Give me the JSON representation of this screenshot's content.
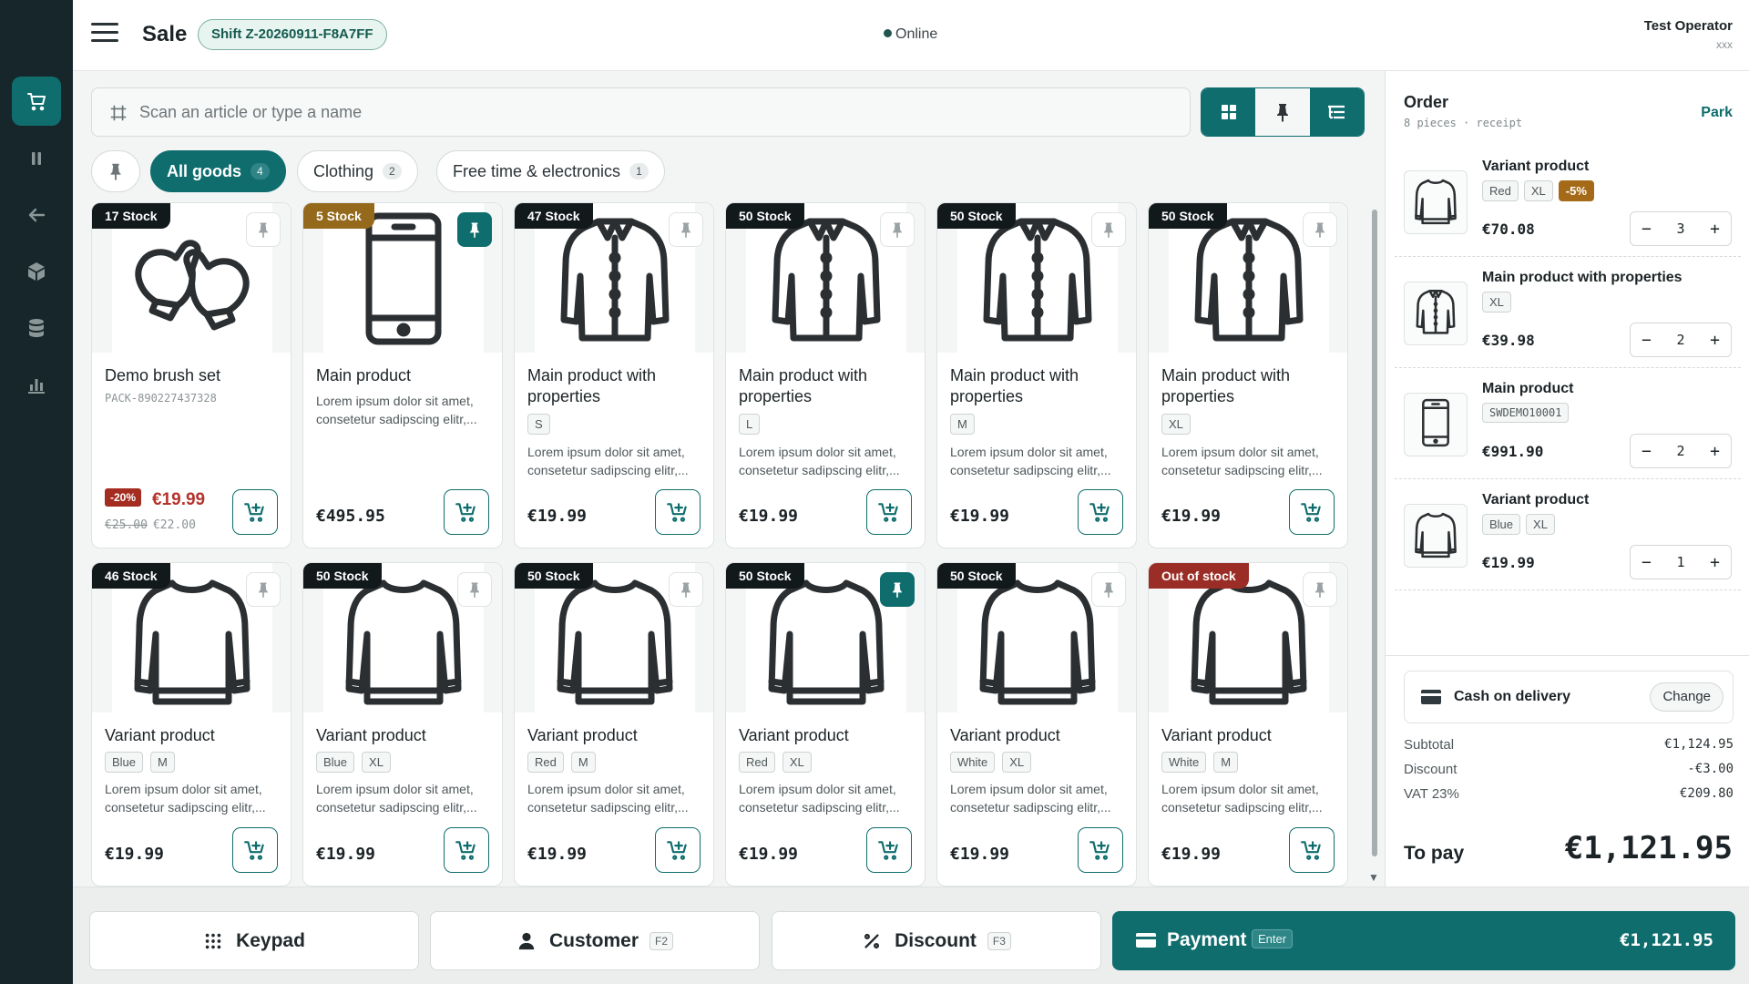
{
  "header": {
    "title": "Sale",
    "shift": "Shift Z-20260911-F8A7FF",
    "status": "Online",
    "user_name": "Test Operator",
    "user_sub": "xxx"
  },
  "rail": {
    "items": [
      "cart-icon",
      "pause-icon",
      "arrow-left-icon",
      "package-icon",
      "database-icon",
      "chart-icon"
    ],
    "active": "cart-icon"
  },
  "search": {
    "placeholder": "Scan an article or type a name",
    "value": ""
  },
  "view_toggle": {
    "icons": [
      "grid-icon",
      "pin-icon",
      "tree-icon"
    ]
  },
  "categories": [
    {
      "label": "All goods",
      "count": "4",
      "active": true
    },
    {
      "label": "Clothing",
      "count": "2"
    },
    {
      "label": "Free time & electronics",
      "count": "1"
    }
  ],
  "products": [
    {
      "stock": "17 Stock",
      "name": "Demo brush set",
      "sku": "PACK-890227437328",
      "discount_badge": "-20%",
      "price": "€19.99",
      "old_price": "€25.00",
      "old_price2": "€22.00",
      "image": "mittens",
      "pinned": false
    },
    {
      "stock": "5 Stock",
      "stock_level": "low",
      "name": "Main product",
      "desc": "Lorem ipsum dolor sit amet, consetetur sadipscing elitr,...",
      "price": "€495.95",
      "image": "phone",
      "pinned": true
    },
    {
      "stock": "47 Stock",
      "name": "Main product with properties",
      "tags": [
        "S"
      ],
      "desc": "Lorem ipsum dolor sit amet, consetetur sadipscing elitr,...",
      "price": "€19.99",
      "image": "jacket"
    },
    {
      "stock": "50 Stock",
      "name": "Main product with properties",
      "tags": [
        "L"
      ],
      "desc": "Lorem ipsum dolor sit amet, consetetur sadipscing elitr,...",
      "price": "€19.99",
      "image": "jacket"
    },
    {
      "stock": "50 Stock",
      "name": "Main product with properties",
      "tags": [
        "M"
      ],
      "desc": "Lorem ipsum dolor sit amet, consetetur sadipscing elitr,...",
      "price": "€19.99",
      "image": "jacket"
    },
    {
      "stock": "50 Stock",
      "name": "Main product with properties",
      "tags": [
        "XL"
      ],
      "desc": "Lorem ipsum dolor sit amet, consetetur sadipscing elitr,...",
      "price": "€19.99",
      "image": "jacket"
    },
    {
      "stock": "46 Stock",
      "name": "Variant product",
      "tags": [
        "Blue",
        "M"
      ],
      "desc": "Lorem ipsum dolor sit amet, consetetur sadipscing elitr,...",
      "price": "€19.99",
      "image": "sweater"
    },
    {
      "stock": "50 Stock",
      "name": "Variant product",
      "tags": [
        "Blue",
        "XL"
      ],
      "desc": "Lorem ipsum dolor sit amet, consetetur sadipscing elitr,...",
      "price": "€19.99",
      "image": "sweater"
    },
    {
      "stock": "50 Stock",
      "name": "Variant product",
      "tags": [
        "Red",
        "M"
      ],
      "desc": "Lorem ipsum dolor sit amet, consetetur sadipscing elitr,...",
      "price": "€19.99",
      "image": "sweater"
    },
    {
      "stock": "50 Stock",
      "name": "Variant product",
      "tags": [
        "Red",
        "XL"
      ],
      "desc": "Lorem ipsum dolor sit amet, consetetur sadipscing elitr,...",
      "price": "€19.99",
      "image": "sweater",
      "pinned": true
    },
    {
      "stock": "50 Stock",
      "name": "Variant product",
      "tags": [
        "White",
        "XL"
      ],
      "desc": "Lorem ipsum dolor sit amet, consetetur sadipscing elitr,...",
      "price": "€19.99",
      "image": "sweater"
    },
    {
      "stock": "Out of stock",
      "stock_level": "out",
      "name": "Variant product",
      "tags": [
        "White",
        "M"
      ],
      "desc": "Lorem ipsum dolor sit amet, consetetur sadipscing elitr,...",
      "price": "€19.99",
      "image": "sweater"
    }
  ],
  "order": {
    "title": "Order",
    "subtitle": "8 pieces · receipt",
    "park_label": "Park",
    "items": [
      {
        "name": "Variant product",
        "tags": [
          "Red",
          "XL"
        ],
        "discount": "-5%",
        "price": "€70.08",
        "qty": "3",
        "image": "sweater"
      },
      {
        "name": "Main product with properties",
        "tags": [
          "XL"
        ],
        "price": "€39.98",
        "qty": "2",
        "image": "jacket"
      },
      {
        "name": "Main product",
        "code": "SWDEMO10001",
        "price": "€991.90",
        "qty": "2",
        "image": "phone"
      },
      {
        "name": "Variant product",
        "tags": [
          "Blue",
          "XL"
        ],
        "price": "€19.99",
        "qty": "1",
        "image": "sweater"
      }
    ],
    "payment_method": "Cash on delivery",
    "change_label": "Change",
    "subtotal_label": "Subtotal",
    "subtotal": "€1,124.95",
    "discount_label": "Discount",
    "discount": "-€3.00",
    "vat_label": "VAT 23%",
    "vat": "€209.80",
    "to_pay_label": "To pay",
    "to_pay": "€1,121.95"
  },
  "bottom": {
    "keypad": "Keypad",
    "customer": "Customer",
    "customer_key": "F2",
    "discount": "Discount",
    "discount_key": "F3",
    "payment": "Payment",
    "payment_key": "Enter",
    "payment_total": "€1,121.95"
  },
  "colors": {
    "accent": "#0f6d6e",
    "rail": "#16262a",
    "discount": "#a42c20",
    "low_stock": "#94691b"
  }
}
